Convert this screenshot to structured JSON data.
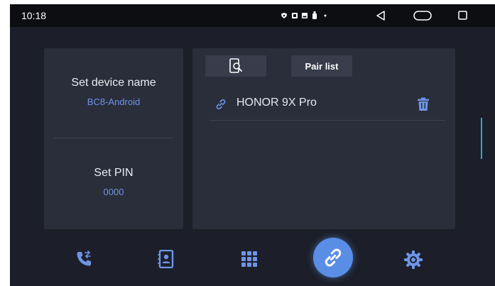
{
  "status_bar": {
    "time": "10:18",
    "icons": [
      "shield-icon",
      "notification-icon",
      "image-icon",
      "usb-icon",
      "dot-icon"
    ],
    "nav": [
      "back-icon",
      "home-icon",
      "recents-icon"
    ]
  },
  "left_panel": {
    "device_name_title": "Set device name",
    "device_name_value": "BC8-Android",
    "pin_title": "Set PIN",
    "pin_value": "0000"
  },
  "right_panel": {
    "tabs": [
      {
        "icon": "phone-search-icon",
        "label": ""
      },
      {
        "label": "Pair list"
      }
    ],
    "devices": [
      {
        "name": "HONOR 9X Pro",
        "icon": "link-icon",
        "action_icon": "trash-icon"
      }
    ]
  },
  "bottom_nav": {
    "items": [
      "phone-transfer-icon",
      "contacts-icon",
      "dialpad-icon",
      "bluetooth-link-icon",
      "settings-icon"
    ],
    "active": "bluetooth-link-icon"
  },
  "colors": {
    "background": "#1c1f29",
    "panel": "#2a2e3b",
    "accent": "#5a8de6",
    "value_text": "#6f94e6",
    "scroll_indicator": "#29a6e0"
  }
}
